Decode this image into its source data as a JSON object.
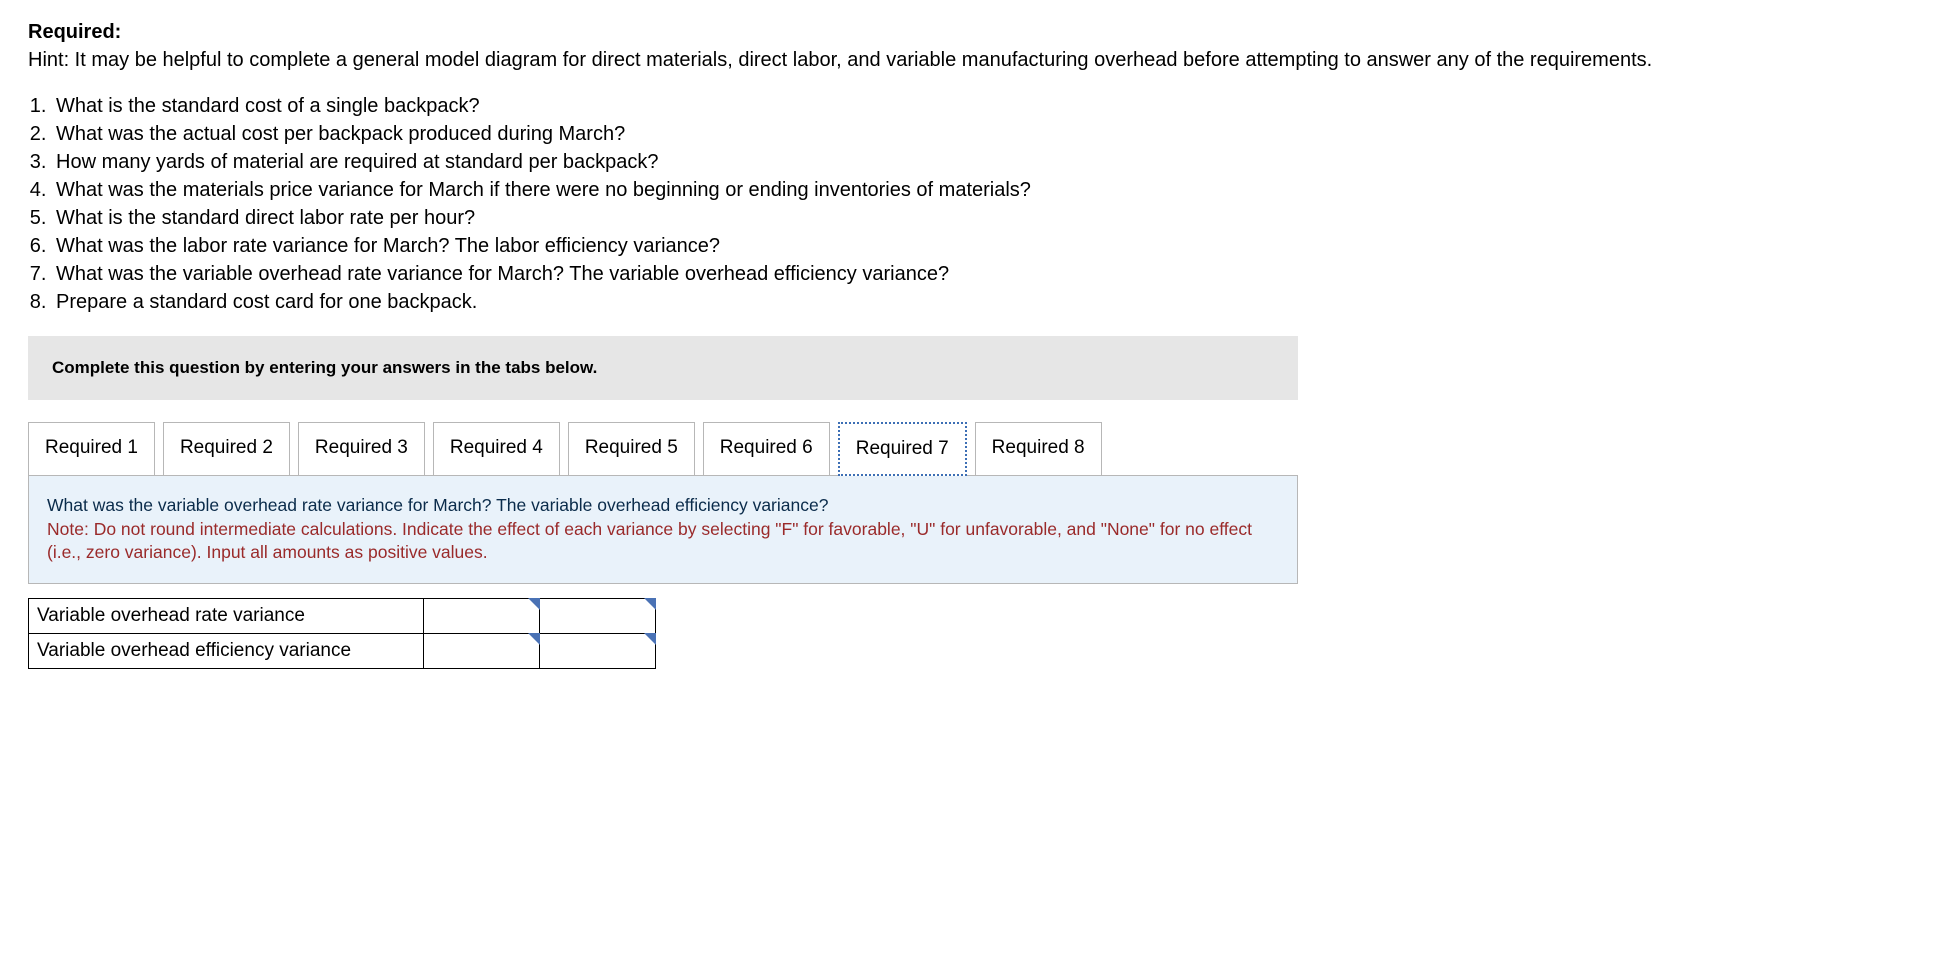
{
  "header": {
    "required_label": "Required:",
    "hint": "Hint:  It may be helpful to complete a general model diagram for direct materials, direct labor, and variable manufacturing overhead before attempting to answer any of the requirements."
  },
  "questions": [
    "What is the standard cost of a single backpack?",
    "What was the actual cost per backpack produced during March?",
    "How many yards of material are required at standard per backpack?",
    "What was the materials price variance for March if there were no beginning or ending inventories of materials?",
    "What is the standard direct labor rate per hour?",
    "What was the labor rate variance for March? The labor efficiency variance?",
    "What was the variable overhead rate variance for March? The variable overhead efficiency variance?",
    "Prepare a standard cost card for one backpack."
  ],
  "instruction": "Complete this question by entering your answers in the tabs below.",
  "tabs": [
    {
      "label": "Required 1"
    },
    {
      "label": "Required 2"
    },
    {
      "label": "Required 3"
    },
    {
      "label": "Required 4"
    },
    {
      "label": "Required 5"
    },
    {
      "label": "Required 6"
    },
    {
      "label": "Required 7"
    },
    {
      "label": "Required 8"
    }
  ],
  "selected_tab": 6,
  "panel": {
    "question": "What was the variable overhead rate variance for March? The variable overhead efficiency variance?",
    "note": "Note: Do not round intermediate calculations. Indicate the effect of each variance by selecting \"F\" for favorable, \"U\" for unfavorable, and \"None\" for no effect (i.e., zero variance). Input all amounts as positive values."
  },
  "answer_rows": [
    {
      "label": "Variable overhead rate variance",
      "amount": "",
      "effect": ""
    },
    {
      "label": "Variable overhead efficiency variance",
      "amount": "",
      "effect": ""
    }
  ]
}
